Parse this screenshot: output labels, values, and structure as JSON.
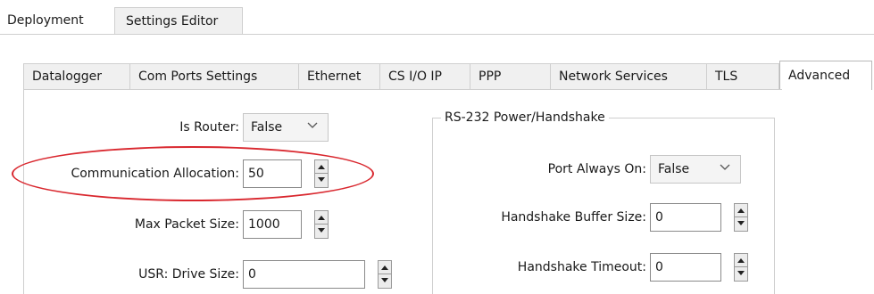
{
  "outer_tabs": [
    {
      "label": "Deployment"
    },
    {
      "label": "Settings Editor"
    }
  ],
  "inner_tabs": [
    {
      "label": "Datalogger"
    },
    {
      "label": "Com Ports Settings"
    },
    {
      "label": "Ethernet"
    },
    {
      "label": "CS I/O IP"
    },
    {
      "label": "PPP"
    },
    {
      "label": "Network Services"
    },
    {
      "label": "TLS"
    },
    {
      "label": "Advanced",
      "active": true
    }
  ],
  "left_fields": {
    "is_router": {
      "label": "Is Router:",
      "value": "False"
    },
    "comm_allocation": {
      "label": "Communication Allocation:",
      "value": "50"
    },
    "max_packet": {
      "label": "Max Packet Size:",
      "value": "1000"
    },
    "usr_drive": {
      "label": "USR: Drive Size:",
      "value": "0"
    }
  },
  "rs232_group": {
    "title": "RS-232 Power/Handshake",
    "port_always_on": {
      "label": "Port Always On:",
      "value": "False"
    },
    "handshake_buffer": {
      "label": "Handshake Buffer Size:",
      "value": "0"
    },
    "handshake_timeout": {
      "label": "Handshake Timeout:",
      "value": "0"
    }
  },
  "annotation": {
    "color": "#d9272e",
    "target": "comm_allocation"
  }
}
